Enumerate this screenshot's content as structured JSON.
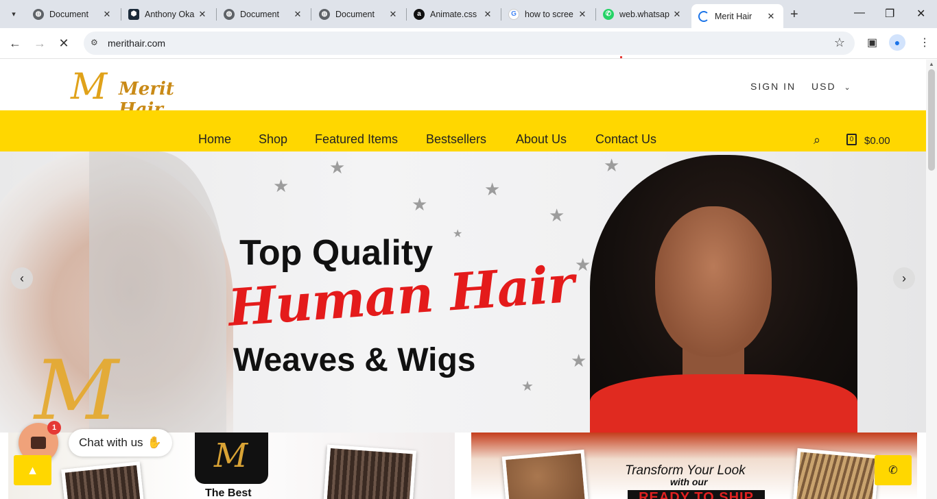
{
  "browser": {
    "tabs": [
      {
        "title": "Document",
        "icon": "globe-icon"
      },
      {
        "title": "Anthony Oka",
        "icon": "hexagon-icon"
      },
      {
        "title": "Document",
        "icon": "globe-icon"
      },
      {
        "title": "Document",
        "icon": "globe-icon"
      },
      {
        "title": "Animate.css",
        "icon": "animate-a-icon"
      },
      {
        "title": "how to scree",
        "icon": "google-g-icon"
      },
      {
        "title": "web.whatsap",
        "icon": "whatsapp-icon"
      },
      {
        "title": "Merit Hair",
        "icon": "loading-icon",
        "active": true
      }
    ],
    "url": "merithair.com"
  },
  "site": {
    "logo_text": "Merit Hair",
    "logo_mark": "M",
    "signin": "SIGN IN",
    "currency": "USD",
    "nav": [
      "Home",
      "Shop",
      "Featured Items",
      "Bestsellers",
      "About Us",
      "Contact Us"
    ],
    "cart_count": "0",
    "cart_total": "$0.00",
    "accent_color": "#FFD700"
  },
  "hero": {
    "line1": "Top Quality",
    "line2": "Human Hair",
    "line3": "Weaves & Wigs"
  },
  "banners": {
    "left_caption": "The Best",
    "right_line1": "Transform Your Look",
    "right_line2": "with our",
    "right_line3": "READY TO SHIP"
  },
  "widgets": {
    "chat_label": "Chat with us",
    "chat_badge": "1"
  }
}
